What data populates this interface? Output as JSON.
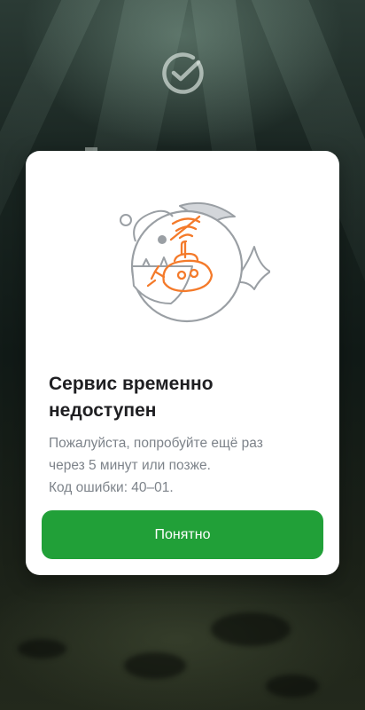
{
  "dialog": {
    "title": "Сервис временно недоступен",
    "message_lines": [
      "Пожалуйста, попробуйте ещё раз",
      "через 5 минут или позже.",
      "Код ошибки: 40–01."
    ],
    "button_label": "Понятно",
    "illustration_icon": "anglerfish-submarine-no-signal-icon"
  },
  "background": {
    "logo_icon": "sber-checkmark-logo-icon"
  },
  "colors": {
    "accent": "#21a038",
    "illustration_orange": "#f47a2a",
    "illustration_gray": "#9a9fa4",
    "title": "#1f1f22",
    "description": "#7d838a"
  }
}
